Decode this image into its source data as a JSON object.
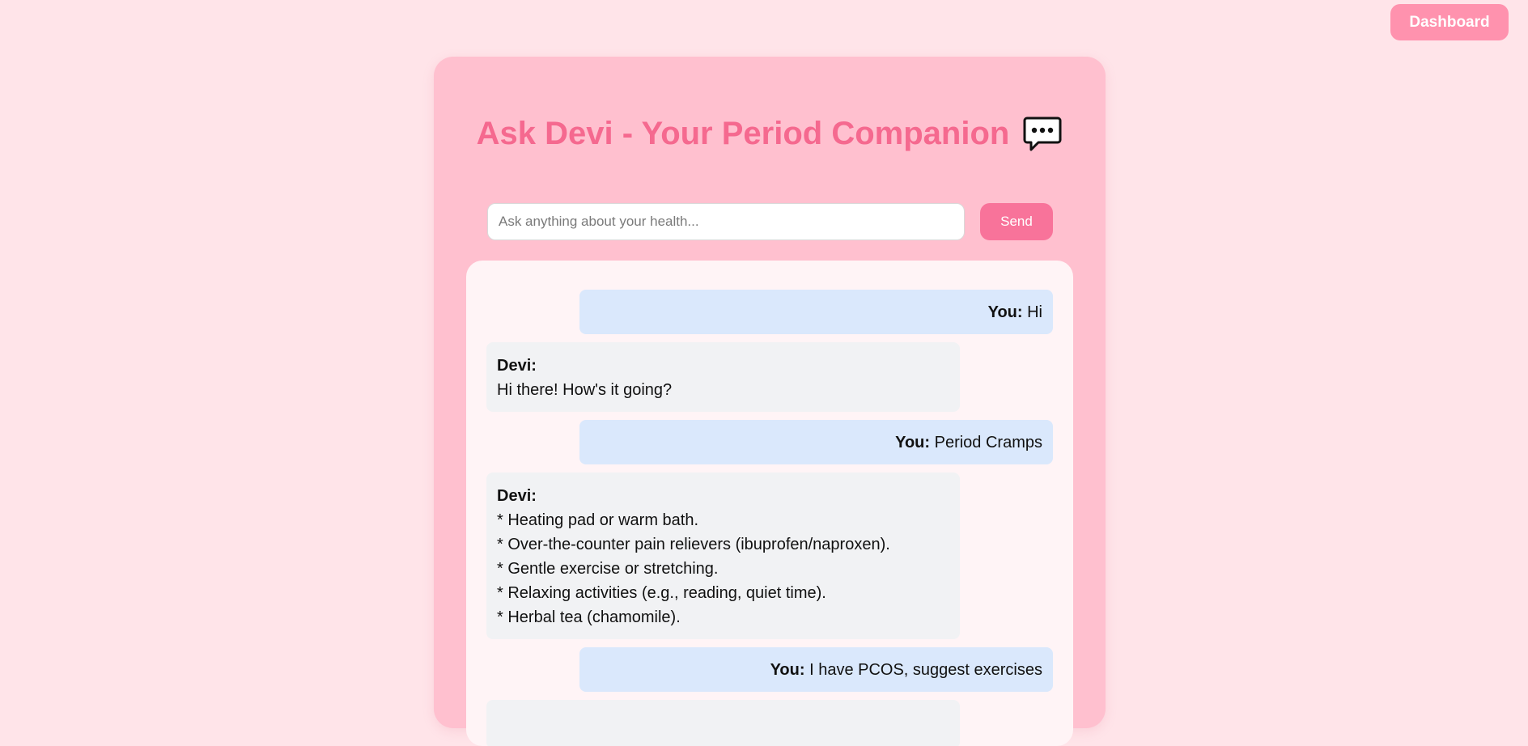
{
  "header": {
    "dashboard_label": "Dashboard"
  },
  "card": {
    "title": "Ask Devi - Your Period Companion",
    "title_icon": "speech-bubble-icon"
  },
  "composer": {
    "placeholder": "Ask anything about your health...",
    "value": "",
    "send_label": "Send"
  },
  "chat": {
    "messages": [
      {
        "role": "user",
        "sender": "You:",
        "text": "Hi"
      },
      {
        "role": "bot",
        "sender": "Devi:",
        "lines": [
          "Hi there! How's it going?"
        ]
      },
      {
        "role": "user",
        "sender": "You:",
        "text": "Period Cramps"
      },
      {
        "role": "bot",
        "sender": "Devi:",
        "lines": [
          "* Heating pad or warm bath.",
          "* Over-the-counter pain relievers (ibuprofen/naproxen).",
          "* Gentle exercise or stretching.",
          "* Relaxing activities (e.g., reading, quiet time).",
          "* Herbal tea (chamomile)."
        ]
      },
      {
        "role": "user",
        "sender": "You:",
        "text": "I have PCOS, suggest exercises"
      },
      {
        "role": "bot",
        "sender": "",
        "lines": [
          ""
        ]
      }
    ]
  },
  "colors": {
    "page_bg": "#ffe4e9",
    "card_bg": "#ffc0cf",
    "title": "#f5698f",
    "send_button": "#f8739a",
    "dashboard_button": "#ff92ae",
    "user_bubble": "#dae8fc",
    "bot_bubble": "#f1f2f4"
  }
}
